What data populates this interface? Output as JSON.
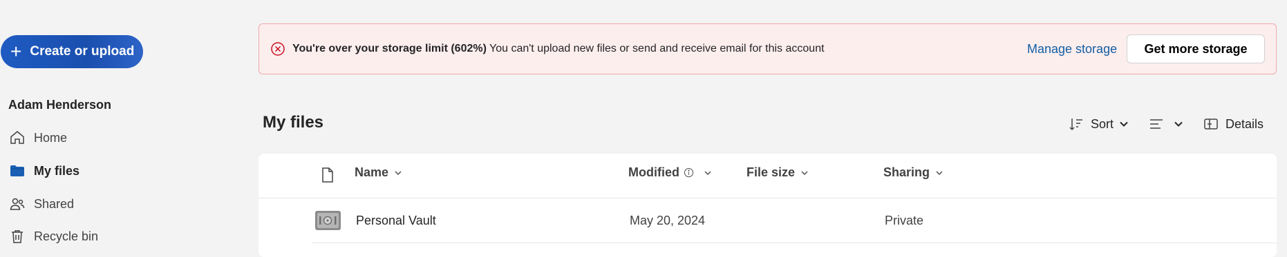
{
  "sidebar": {
    "create_label": "Create or upload",
    "user_name": "Adam Henderson",
    "items": [
      {
        "label": "Home",
        "icon": "home-icon"
      },
      {
        "label": "My files",
        "icon": "folder-icon"
      },
      {
        "label": "Shared",
        "icon": "people-icon"
      },
      {
        "label": "Recycle bin",
        "icon": "trash-icon"
      }
    ]
  },
  "banner": {
    "title": "You're over your storage limit (602%)",
    "message": "You can't upload new files or send and receive email for this account",
    "manage_label": "Manage storage",
    "more_label": "Get more storage"
  },
  "main": {
    "title": "My files",
    "toolbar": {
      "sort_label": "Sort",
      "details_label": "Details"
    },
    "columns": {
      "name": "Name",
      "modified": "Modified",
      "size": "File size",
      "sharing": "Sharing"
    },
    "rows": [
      {
        "name": "Personal Vault",
        "modified": "May 20, 2024",
        "size": "",
        "sharing": "Private"
      }
    ]
  },
  "colors": {
    "accent": "#1f5bc2",
    "error": "#c50f1f",
    "banner_bg": "#fdeeee",
    "link": "#115ea3"
  }
}
